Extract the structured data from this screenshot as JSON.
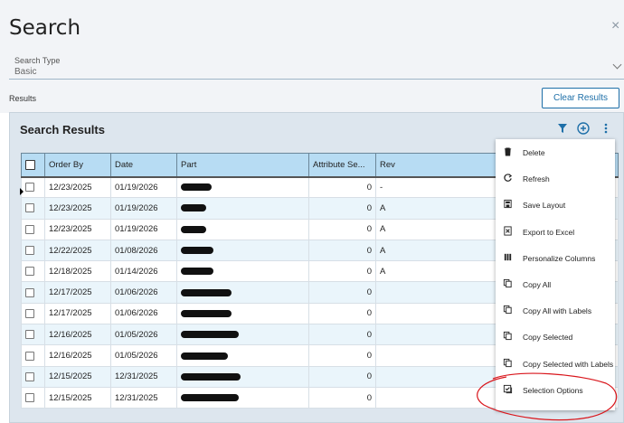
{
  "header": {
    "title": "Search",
    "close_label": "×"
  },
  "search_type": {
    "label": "Search Type",
    "value": "Basic"
  },
  "results": {
    "label": "Results",
    "clear_button": "Clear Results"
  },
  "panel": {
    "title": "Search Results"
  },
  "table": {
    "columns": [
      "Order By",
      "Date",
      "Part",
      "Attribute Se...",
      "Rev"
    ],
    "rows": [
      {
        "order_by": "12/23/2025",
        "date": "01/19/2026",
        "attr": "0",
        "rev": "-"
      },
      {
        "order_by": "12/23/2025",
        "date": "01/19/2026",
        "attr": "0",
        "rev": "A"
      },
      {
        "order_by": "12/23/2025",
        "date": "01/19/2026",
        "attr": "0",
        "rev": "A"
      },
      {
        "order_by": "12/22/2025",
        "date": "01/08/2026",
        "attr": "0",
        "rev": "A"
      },
      {
        "order_by": "12/18/2025",
        "date": "01/14/2026",
        "attr": "0",
        "rev": "A"
      },
      {
        "order_by": "12/17/2025",
        "date": "01/06/2026",
        "attr": "0",
        "rev": ""
      },
      {
        "order_by": "12/17/2025",
        "date": "01/06/2026",
        "attr": "0",
        "rev": ""
      },
      {
        "order_by": "12/16/2025",
        "date": "01/05/2026",
        "attr": "0",
        "rev": ""
      },
      {
        "order_by": "12/16/2025",
        "date": "01/05/2026",
        "attr": "0",
        "rev": ""
      },
      {
        "order_by": "12/15/2025",
        "date": "12/31/2025",
        "attr": "0",
        "rev": ""
      },
      {
        "order_by": "12/15/2025",
        "date": "12/31/2025",
        "attr": "0",
        "rev": ""
      }
    ]
  },
  "menu": {
    "items": [
      {
        "label": "Delete",
        "icon": "trash-icon"
      },
      {
        "label": "Refresh",
        "icon": "refresh-icon"
      },
      {
        "label": "Save Layout",
        "icon": "save-layout-icon"
      },
      {
        "label": "Export to Excel",
        "icon": "excel-icon"
      },
      {
        "label": "Personalize Columns",
        "icon": "columns-icon"
      },
      {
        "label": "Copy All",
        "icon": "copy-icon"
      },
      {
        "label": "Copy All with Labels",
        "icon": "copy-icon"
      },
      {
        "label": "Copy Selected",
        "icon": "copy-icon"
      },
      {
        "label": "Copy Selected with Labels",
        "icon": "copy-icon"
      },
      {
        "label": "Selection Options",
        "icon": "selection-options-icon"
      }
    ]
  },
  "colors": {
    "accent": "#1e6fa8",
    "header_bg": "#b7dcf3",
    "annotation": "#d9161c"
  }
}
